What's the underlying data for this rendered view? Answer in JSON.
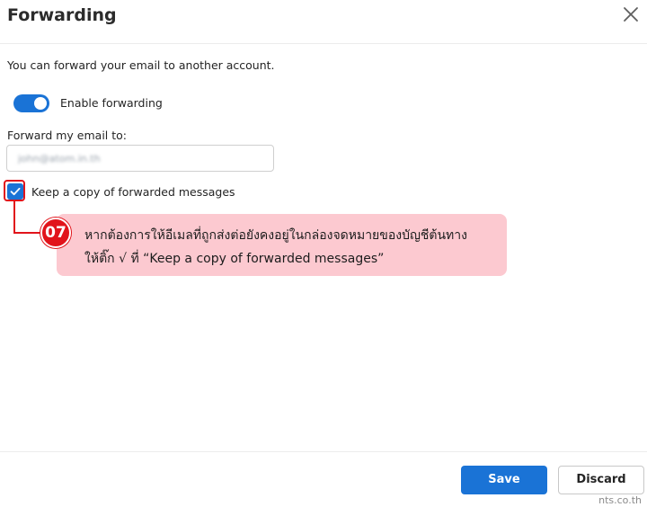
{
  "dialog": {
    "title": "Forwarding",
    "description": "You can forward your email to another account."
  },
  "forwarding_toggle": {
    "label": "Enable forwarding",
    "enabled": true
  },
  "forward_to": {
    "label": "Forward my email to:",
    "value": "john@atom.in.th"
  },
  "keep_copy": {
    "label": "Keep a copy of forwarded messages",
    "checked": true
  },
  "annotation": {
    "step": "07",
    "line1": "หากต้องการให้อีเมลที่ถูกส่งต่อยังคงอยู่ในกล่องจดหมายของบัญชีต้นทาง",
    "line2": "ให้ติ๊ก √ ที่ “Keep a copy of forwarded messages”"
  },
  "footer": {
    "save_label": "Save",
    "discard_label": "Discard"
  },
  "watermark": "nts.co.th",
  "colors": {
    "accent": "#1a73d6",
    "annotation_red": "#e1141b",
    "callout_pink": "#fcc9d0"
  }
}
